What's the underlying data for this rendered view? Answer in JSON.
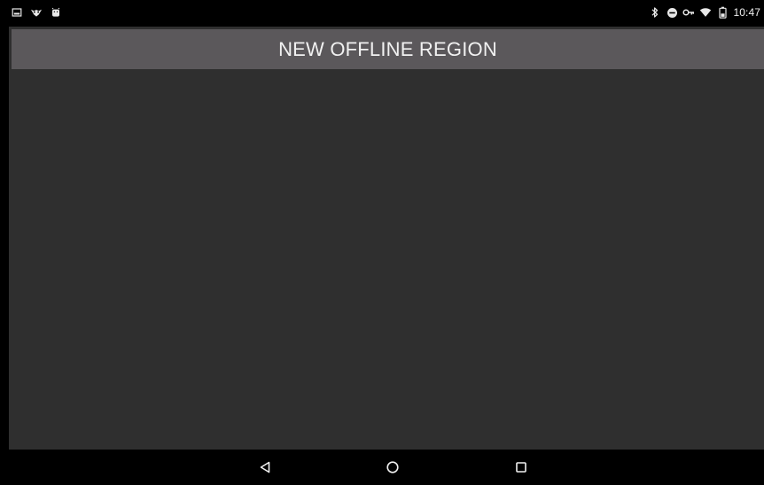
{
  "status_bar": {
    "left_icons": [
      "screenshot-icon",
      "owl-icon",
      "android-icon"
    ],
    "right_icons": [
      "bluetooth-icon",
      "do-not-disturb-icon",
      "vpn-key-icon",
      "wifi-icon",
      "battery-icon"
    ],
    "clock": "10:47"
  },
  "header": {
    "title": "NEW OFFLINE REGION"
  },
  "navigation": {
    "back_icon": "back-triangle-icon",
    "home_icon": "home-circle-icon",
    "recents_icon": "recents-square-icon"
  },
  "colors": {
    "status_bar": "#000000",
    "top_bar": "#5b585b",
    "content_background": "#2f2f2f",
    "text": "#f1f1f1",
    "nav_bar": "#000000"
  }
}
